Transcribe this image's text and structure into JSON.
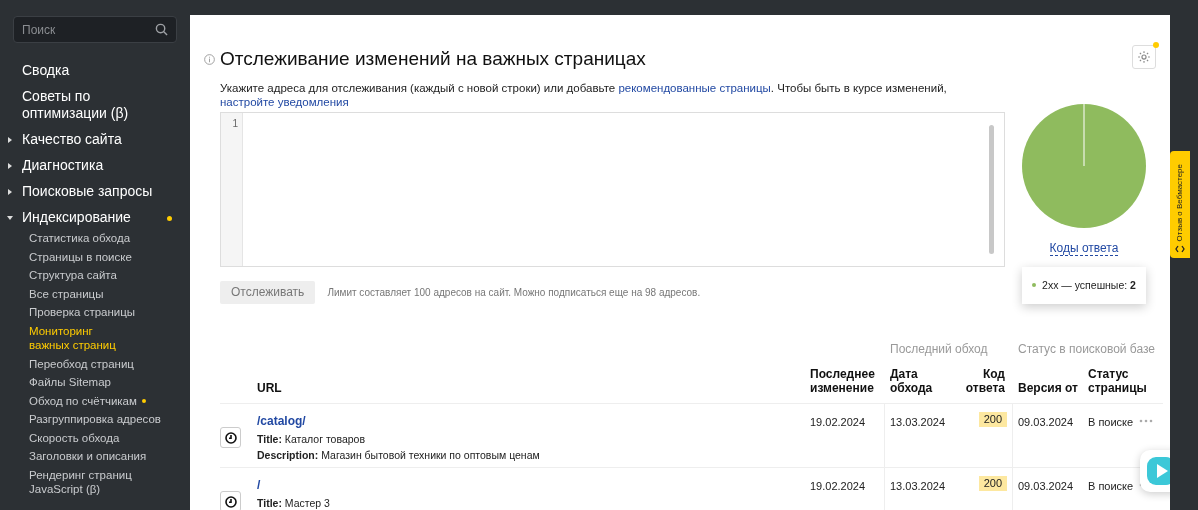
{
  "search": {
    "placeholder": "Поиск"
  },
  "sidebar": {
    "items": [
      {
        "kind": "link",
        "label": "Сводка"
      },
      {
        "kind": "link",
        "label": "Советы по оптимизации (β)"
      },
      {
        "kind": "group",
        "label": "Качество сайта",
        "expanded": false
      },
      {
        "kind": "group",
        "label": "Диагностика",
        "expanded": false
      },
      {
        "kind": "group",
        "label": "Поисковые запросы",
        "expanded": false
      },
      {
        "kind": "group",
        "label": "Индексирование",
        "expanded": true,
        "dot": true,
        "children": [
          {
            "label": "Статистика обхода",
            "selected": false,
            "dot": false
          },
          {
            "label": "Страницы в поиске",
            "selected": false,
            "dot": false
          },
          {
            "label": "Структура сайта",
            "selected": false,
            "dot": false
          },
          {
            "label": "Все страницы",
            "selected": false,
            "dot": false
          },
          {
            "label": "Проверка страницы",
            "selected": false,
            "dot": false
          },
          {
            "label": "Мониторинг важных страниц",
            "selected": true,
            "dot": false
          },
          {
            "label": "Переобход страниц",
            "selected": false,
            "dot": false
          },
          {
            "label": "Файлы Sitemap",
            "selected": false,
            "dot": false
          },
          {
            "label": "Обход по счётчикам",
            "selected": false,
            "dot": true
          },
          {
            "label": "Разгруппировка адресов",
            "selected": false,
            "dot": false
          },
          {
            "label": "Скорость обхода",
            "selected": false,
            "dot": false
          },
          {
            "label": "Заголовки и описания",
            "selected": false,
            "dot": false
          },
          {
            "label": "Рендеринг страниц JavaScript (β)",
            "selected": false,
            "dot": false
          }
        ]
      }
    ]
  },
  "page": {
    "title": "Отслеживание изменений на важных страницах",
    "settings_notice": true,
    "intro": [
      {
        "kind": "text",
        "text": "Укажите адреса для отслеживания (каждый с новой строки) или добавьте "
      },
      {
        "kind": "link",
        "text": "рекомендованные страницы"
      },
      {
        "kind": "text",
        "text": ". Чтобы быть в курсе изменений, "
      },
      {
        "kind": "link",
        "text": "настройте уведомления"
      }
    ],
    "editor": {
      "line_numbers": [
        "1"
      ]
    },
    "track_button": {
      "label": "Отслеживать",
      "disabled": true
    },
    "limit_note": "Лимит составляет 100 адресов на сайт. Можно подписаться еще на 98 адресов."
  },
  "response_codes": {
    "link": "Коды ответа",
    "tooltip": {
      "items": [
        {
          "color": "#8fbb5e",
          "text": "2xx — успешные: **2**"
        }
      ]
    }
  },
  "table": {
    "group_headers": [
      "Последний обход",
      "Статус в поисковой базе"
    ],
    "columns": [
      "URL",
      "Последнее изменение",
      "Дата обхода",
      "Код ответа",
      "Версия от",
      "Статус страницы"
    ],
    "rows": [
      {
        "url": "/catalog/",
        "lines": [
          "**Title:** Каталог товаров",
          "**Description:** Магазин бытовой техники по оптовым ценам"
        ],
        "last_change": "19.02.2024",
        "crawl_date": "13.03.2024",
        "code": "200",
        "version": "09.03.2024",
        "status": "В поиске"
      },
      {
        "url": "/",
        "lines": [
          "**Title:** Мастер 3"
        ],
        "last_change": "19.02.2024",
        "crawl_date": "13.03.2024",
        "code": "200",
        "version": "09.03.2024",
        "status": "В поиске"
      }
    ]
  },
  "feedback_tab": {
    "label": "Отзыв о Вебмастере"
  }
}
